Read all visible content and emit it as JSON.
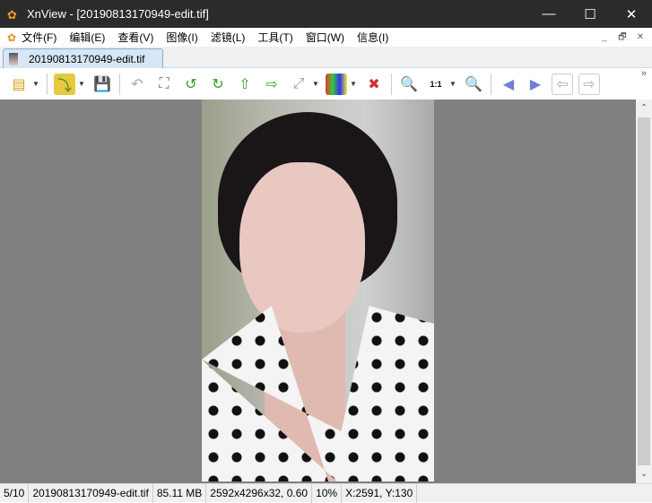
{
  "window": {
    "title": "XnView - [20190813170949-edit.tif]",
    "minimize": "—",
    "maximize": "☐",
    "close": "✕"
  },
  "menu": {
    "items": [
      "文件(F)",
      "编辑(E)",
      "查看(V)",
      "图像(I)",
      "滤镜(L)",
      "工具(T)",
      "窗口(W)",
      "信息(I)"
    ],
    "mdi": [
      "_",
      "🗗",
      "✕"
    ]
  },
  "tab": {
    "label": "20190813170949-edit.tif"
  },
  "toolbar": {
    "more": "»",
    "zoom_1to1": "1:1"
  },
  "status": {
    "index": "5/10",
    "filename": "20190813170949-edit.tif",
    "size": "85.11 MB",
    "dimensions": "2592x4296x32, 0.60",
    "zoom": "10%",
    "coords": "X:2591, Y:130"
  },
  "scrollbar": {
    "up": "⌃",
    "down": "⌄"
  }
}
